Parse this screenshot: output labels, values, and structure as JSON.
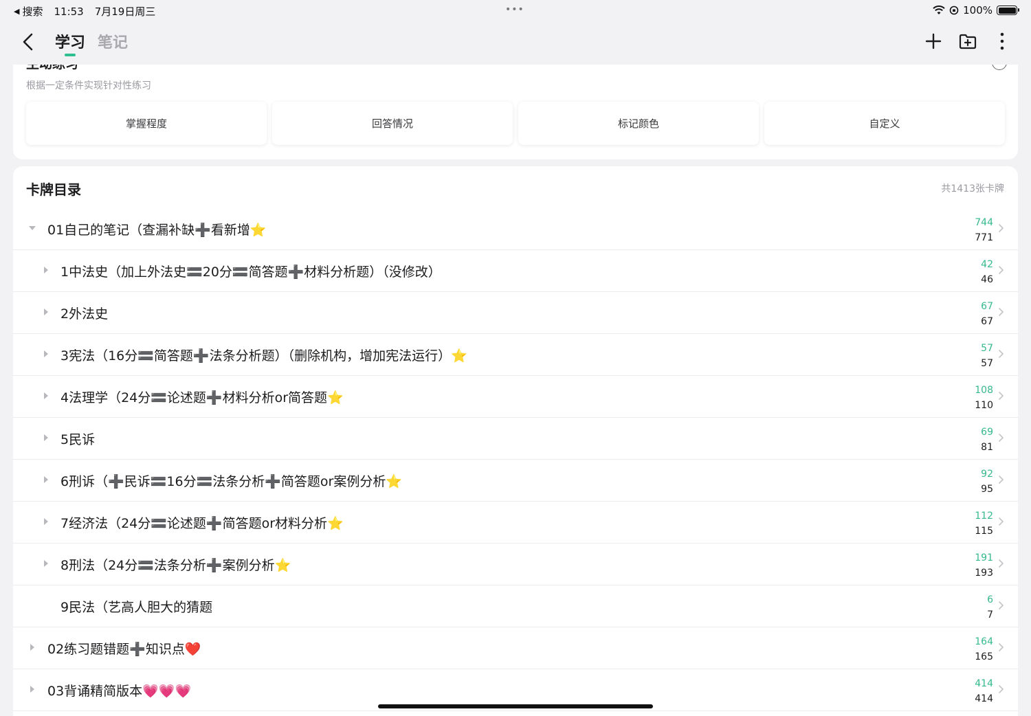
{
  "status_bar": {
    "back_app": "搜索",
    "time": "11:53",
    "date": "7月19日周三",
    "battery": "100%"
  },
  "nav": {
    "tabs": [
      {
        "label": "学习",
        "active": true
      },
      {
        "label": "笔记",
        "active": false
      }
    ],
    "accent_color": "#2fbf8f"
  },
  "practice": {
    "title": "主动练习",
    "subtitle": "根据一定条件实现针对性练习",
    "chips": [
      "掌握程度",
      "回答情况",
      "标记颜色",
      "自定义"
    ]
  },
  "decks": {
    "title": "卡牌目录",
    "total": "共1413张卡牌",
    "due_color": "#35b98b",
    "rows": [
      {
        "label": "01自己的笔记（查漏补缺➕看新增⭐️",
        "due": "744",
        "total": "771",
        "level": "top",
        "expanded": true
      },
      {
        "label": "1中法史（加上外法史🟰20分🟰简答题➕材料分析题）（没修改）",
        "due": "42",
        "total": "46",
        "level": "sub",
        "expanded": false
      },
      {
        "label": "2外法史",
        "due": "67",
        "total": "67",
        "level": "sub",
        "expanded": false
      },
      {
        "label": "3宪法（16分🟰简答题➕法条分析题）（删除机构，增加宪法运行）⭐️",
        "due": "57",
        "total": "57",
        "level": "sub",
        "expanded": false
      },
      {
        "label": "4法理学（24分🟰论述题➕材料分析or简答题⭐️",
        "due": "108",
        "total": "110",
        "level": "sub",
        "expanded": false
      },
      {
        "label": "5民诉",
        "due": "69",
        "total": "81",
        "level": "sub",
        "expanded": false
      },
      {
        "label": "6刑诉（➕民诉🟰16分🟰法条分析➕简答题or案例分析⭐️",
        "due": "92",
        "total": "95",
        "level": "sub",
        "expanded": false
      },
      {
        "label": "7经济法（24分🟰论述题➕简答题or材料分析⭐️",
        "due": "112",
        "total": "115",
        "level": "sub",
        "expanded": false
      },
      {
        "label": "8刑法（24分🟰法条分析➕案例分析⭐️",
        "due": "191",
        "total": "193",
        "level": "sub",
        "expanded": false
      },
      {
        "label": "9民法（艺高人胆大的猜题",
        "due": "6",
        "total": "7",
        "level": "sub",
        "expanded": null
      },
      {
        "label": "02练习题错题➕知识点❤️",
        "due": "164",
        "total": "165",
        "level": "top",
        "expanded": false
      },
      {
        "label": "03背诵精简版本💗💗💗",
        "due": "414",
        "total": "414",
        "level": "top",
        "expanded": false
      }
    ]
  }
}
